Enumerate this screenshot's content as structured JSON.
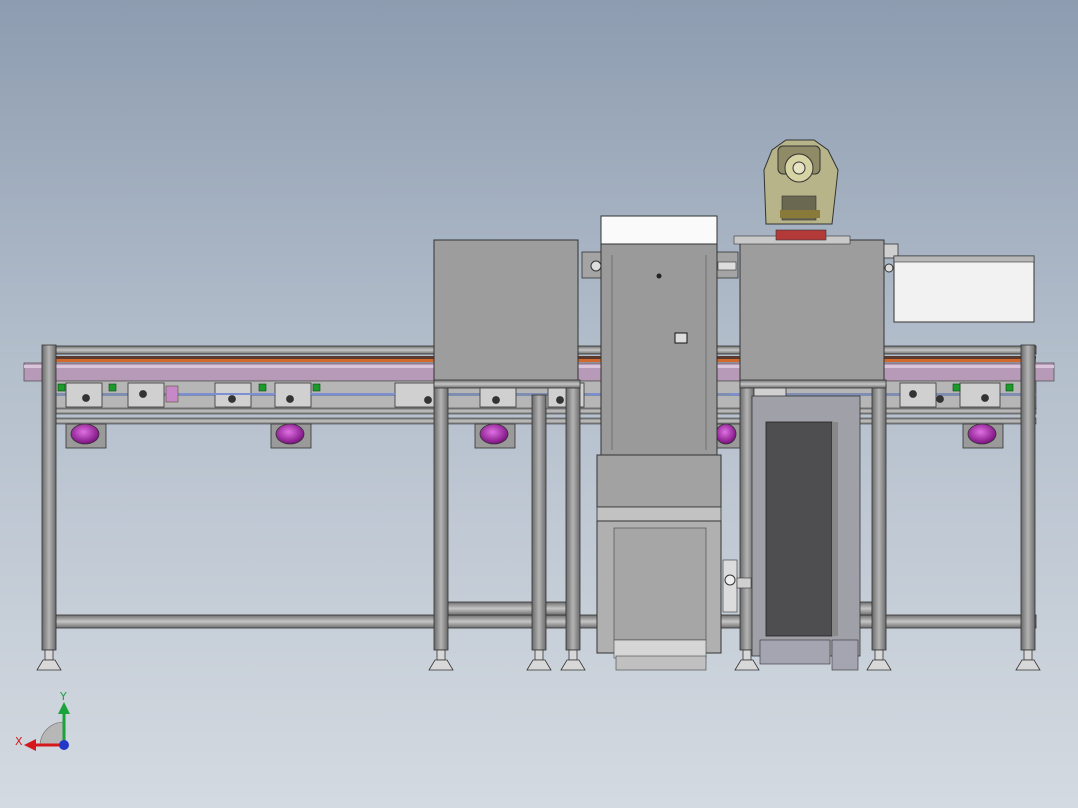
{
  "triad": {
    "x_label": "X",
    "y_label": "Y",
    "x_color": "#d4181c",
    "y_color": "#1aa33a",
    "z_color": "#2236c8"
  },
  "colors": {
    "frame": "#8e8e8e",
    "frame_dark": "#4a4a4a",
    "panel": "#9d9d9d",
    "slot": "#c8a8c8",
    "motor": "#9a1aa0",
    "bracket_green": "#1c9a2c",
    "robot": "#b7b48a"
  }
}
